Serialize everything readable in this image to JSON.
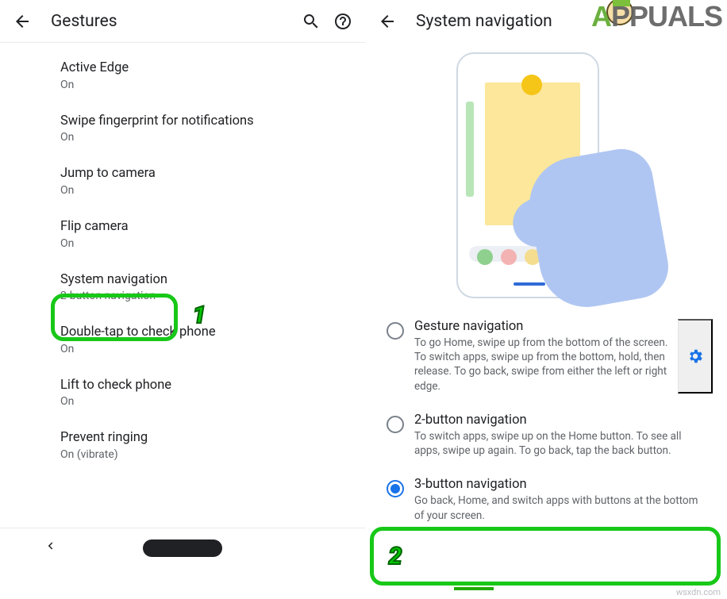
{
  "watermark": {
    "prefix": "A",
    "rest": "PPUALS"
  },
  "footer_url": "wsxdn.com",
  "left": {
    "title": "Gestures",
    "items": [
      {
        "label": "Active Edge",
        "sub": "On"
      },
      {
        "label": "Swipe fingerprint for notifications",
        "sub": "On"
      },
      {
        "label": "Jump to camera",
        "sub": "On"
      },
      {
        "label": "Flip camera",
        "sub": "On"
      },
      {
        "label": "System navigation",
        "sub": "2-button navigation"
      },
      {
        "label": "Double-tap to check phone",
        "sub": "On"
      },
      {
        "label": "Lift to check phone",
        "sub": "On"
      },
      {
        "label": "Prevent ringing",
        "sub": "On (vibrate)"
      }
    ],
    "callout": "1"
  },
  "right": {
    "title": "System navigation",
    "options": [
      {
        "title": "Gesture navigation",
        "desc": "To go Home, swipe up from the bottom of the screen. To switch apps, swipe up from the bottom, hold, then release. To go back, swipe from either the left or right edge.",
        "selected": false,
        "has_settings": true
      },
      {
        "title": "2-button navigation",
        "desc": "To switch apps, swipe up on the Home button. To see all apps, swipe up again. To go back, tap the back button.",
        "selected": false,
        "has_settings": false
      },
      {
        "title": "3-button navigation",
        "desc": "Go back, Home, and switch apps with buttons at the bottom of your screen.",
        "selected": true,
        "has_settings": false
      }
    ],
    "callout": "2"
  }
}
